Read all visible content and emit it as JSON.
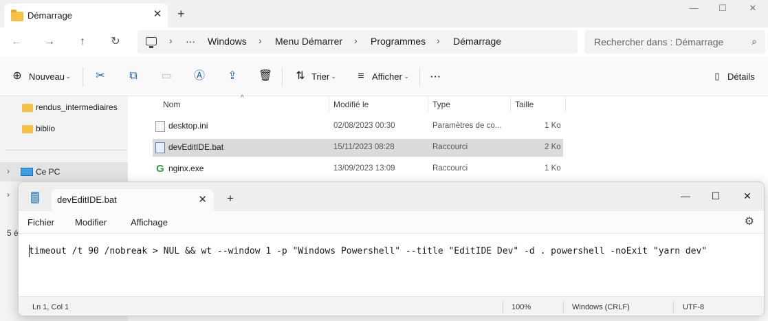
{
  "explorer": {
    "tab_title": "Démarrage",
    "window_controls": {
      "minimize": "—",
      "maximize": "☐",
      "close": "✕"
    },
    "nav": {
      "back": "←",
      "forward": "→",
      "up": "↑",
      "refresh": "↻",
      "more": "···"
    },
    "breadcrumb": [
      "Windows",
      "Menu Démarrer",
      "Programmes",
      "Démarrage"
    ],
    "search_placeholder": "Rechercher dans : Démarrage",
    "commands": {
      "new_label": "Nouveau",
      "sort_label": "Trier",
      "view_label": "Afficher",
      "more": "···",
      "details_label": "Détails"
    },
    "sidebar": {
      "items": [
        "rendus_intermediaires",
        "biblio"
      ],
      "this_pc": "Ce PC"
    },
    "columns": {
      "name": "Nom",
      "modified": "Modifié le",
      "type": "Type",
      "size": "Taille"
    },
    "files": [
      {
        "name": "desktop.ini",
        "modified": "02/08/2023 00:30",
        "type": "Paramètres de co...",
        "size": "1 Ko"
      },
      {
        "name": "devEditIDE.bat",
        "modified": "15/11/2023 08:28",
        "type": "Raccourci",
        "size": "2 Ko"
      },
      {
        "name": "nginx.exe",
        "modified": "13/09/2023 13:09",
        "type": "Raccourci",
        "size": "1 Ko"
      }
    ],
    "status_count": "5 é"
  },
  "notepad": {
    "tab_title": "devEditIDE.bat",
    "window_controls": {
      "minimize": "—",
      "maximize": "☐",
      "close": "✕"
    },
    "menu": {
      "file": "Fichier",
      "edit": "Modifier",
      "view": "Affichage"
    },
    "content": "timeout /t 90 /nobreak > NUL && wt --window 1 -p \"Windows Powershell\" --title \"EditIDE Dev\" -d . powershell -noExit \"yarn dev\"",
    "status": {
      "position": "Ln 1, Col 1",
      "zoom": "100%",
      "line_ending": "Windows (CRLF)",
      "encoding": "UTF-8"
    }
  }
}
